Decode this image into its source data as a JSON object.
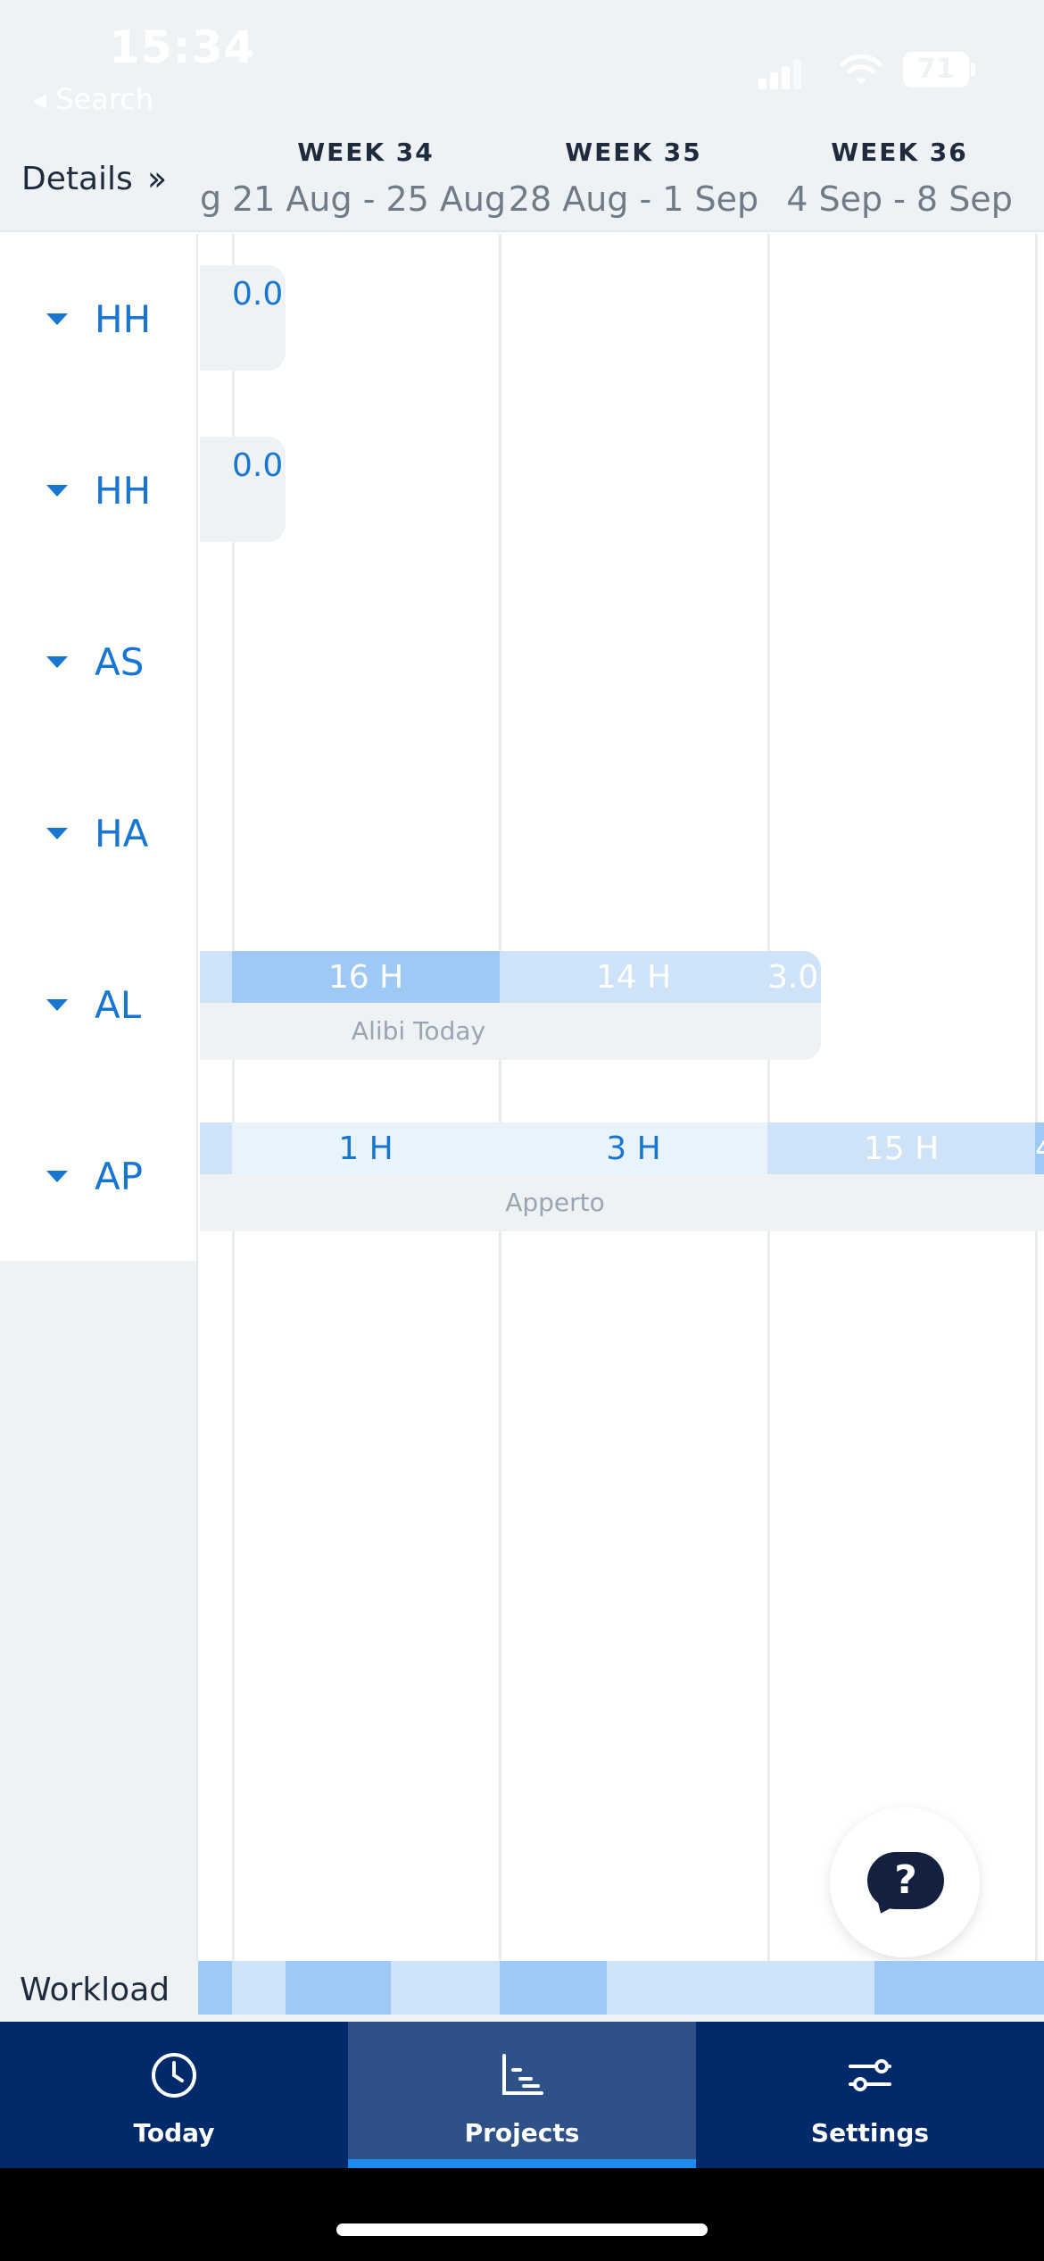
{
  "status_bar": {
    "time": "15:34",
    "back_label": "◂ Search",
    "battery": "71"
  },
  "header": {
    "details_label": "Details",
    "partial_prev": "g",
    "weeks": [
      {
        "label": "WEEK 34",
        "range": "21 Aug - 25 Aug"
      },
      {
        "label": "WEEK 35",
        "range": "28 Aug - 1 Sep"
      },
      {
        "label": "WEEK 36",
        "range": "4 Sep - 8 Sep"
      }
    ]
  },
  "rows": [
    {
      "label": "HH",
      "value": "0.0"
    },
    {
      "label": "HH",
      "value": "0.0"
    },
    {
      "label": "AS"
    },
    {
      "label": "HA"
    },
    {
      "label": "AL",
      "project": "Alibi Today",
      "hours": [
        "16 H",
        "14 H",
        "3.0"
      ]
    },
    {
      "label": "AP",
      "project": "Apperto",
      "hours": [
        "1 H",
        "3 H",
        "15 H",
        "4"
      ]
    }
  ],
  "colors": {
    "accent": "#1676d2",
    "bar_strong": "#9ec9f5",
    "bar_light": "#cfe3f8",
    "bar_faint": "#e9f3fc",
    "tabbar": "#012a6a",
    "tab_active": "#2e5188"
  },
  "workload": {
    "label": "Workload"
  },
  "tabs": [
    {
      "label": "Today",
      "icon": "clock-icon"
    },
    {
      "label": "Projects",
      "icon": "chart-icon",
      "active": true
    },
    {
      "label": "Settings",
      "icon": "sliders-icon"
    }
  ]
}
